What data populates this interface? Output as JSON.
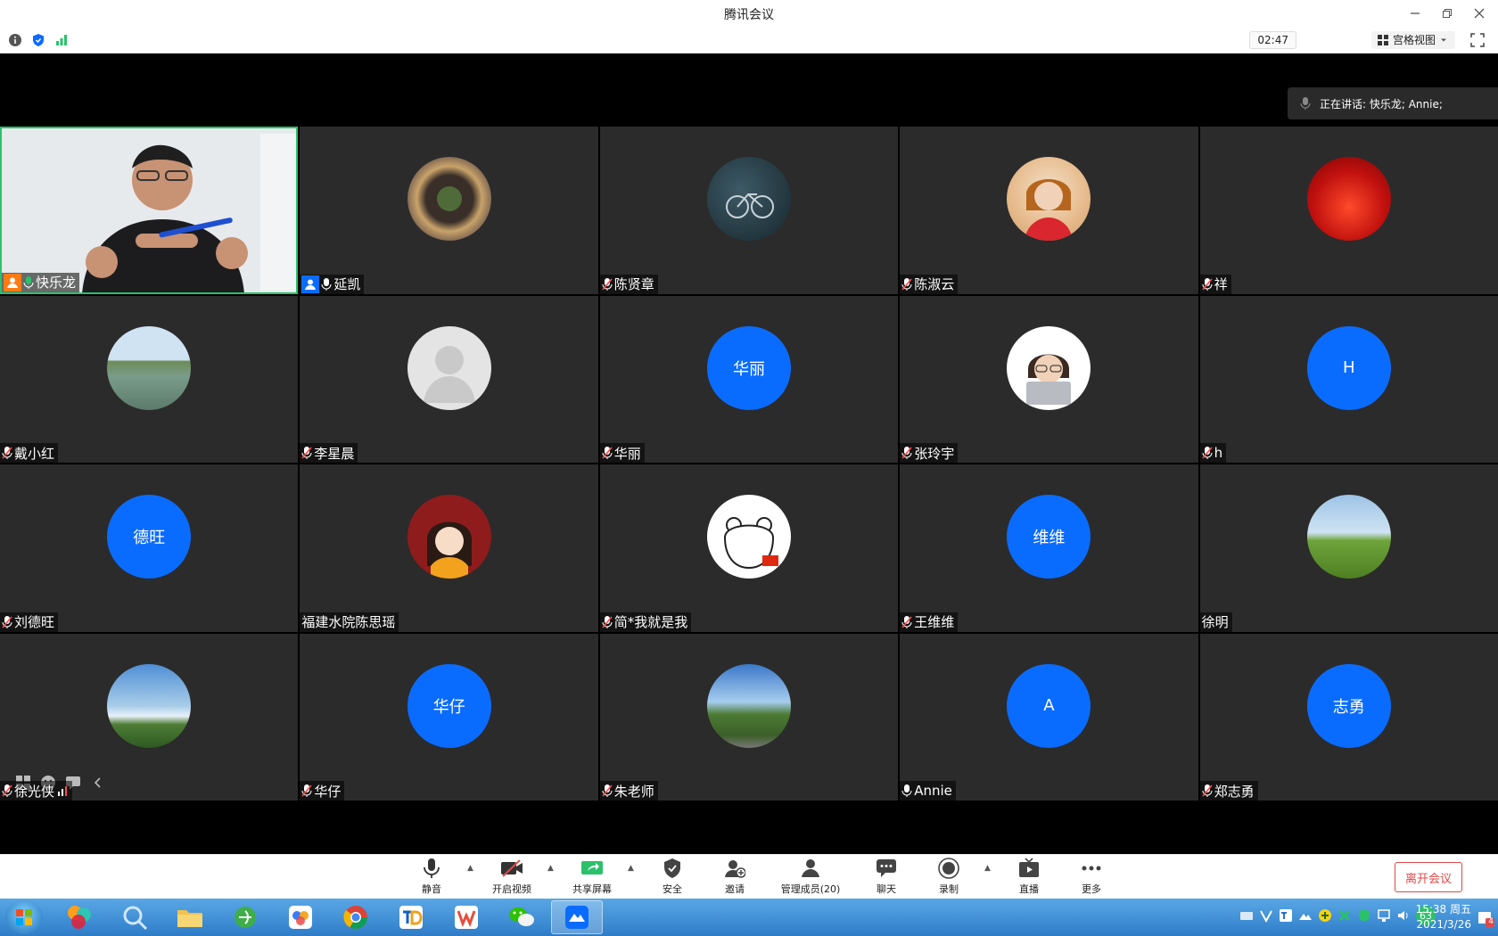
{
  "window": {
    "title": "腾讯会议"
  },
  "toolbar": {
    "timer": "02:47",
    "view_label": "宫格视图"
  },
  "speaking": {
    "text": "正在讲话: 快乐龙; Annie;"
  },
  "participants": [
    {
      "name": "快乐龙",
      "type": "video",
      "mic": "on",
      "host": "orange"
    },
    {
      "name": "延凯",
      "type": "photo",
      "mic": "on",
      "host": "blue"
    },
    {
      "name": "陈贤章",
      "type": "photo",
      "mic": "muted"
    },
    {
      "name": "陈淑云",
      "type": "photo",
      "mic": "muted"
    },
    {
      "name": "祥",
      "type": "photo",
      "mic": "muted"
    },
    {
      "name": "戴小红",
      "type": "photo",
      "mic": "muted"
    },
    {
      "name": "李星晨",
      "type": "default",
      "mic": "muted"
    },
    {
      "name": "华丽",
      "type": "initials",
      "initials": "华丽",
      "mic": "muted"
    },
    {
      "name": "张玲宇",
      "type": "photo",
      "mic": "muted"
    },
    {
      "name": "h",
      "type": "initials",
      "initials": "H",
      "mic": "muted"
    },
    {
      "name": "刘德旺",
      "type": "initials",
      "initials": "德旺",
      "mic": "muted"
    },
    {
      "name": "福建水院陈思瑶",
      "type": "photo",
      "mic": "none"
    },
    {
      "name": "简*我就是我",
      "type": "photo",
      "mic": "muted"
    },
    {
      "name": "王维维",
      "type": "initials",
      "initials": "维维",
      "mic": "muted"
    },
    {
      "name": "徐明",
      "type": "photo",
      "mic": "none"
    },
    {
      "name": "徐光侠",
      "type": "photo",
      "mic": "muted"
    },
    {
      "name": "华仔",
      "type": "initials",
      "initials": "华仔",
      "mic": "muted"
    },
    {
      "name": "朱老师",
      "type": "photo",
      "mic": "muted"
    },
    {
      "name": "Annie",
      "type": "initials",
      "initials": "A",
      "mic": "on"
    },
    {
      "name": "郑志勇",
      "type": "initials",
      "initials": "志勇",
      "mic": "muted"
    }
  ],
  "controls": {
    "mute": "静音",
    "video": "开启视频",
    "share": "共享屏幕",
    "security": "安全",
    "invite": "邀请",
    "members": "管理成员(20)",
    "chat": "聊天",
    "record": "录制",
    "live": "直播",
    "more": "更多",
    "leave": "离开会议"
  },
  "taskbar": {
    "time": "15:38 周五",
    "date": "2021/3/26",
    "tray_badge": "63",
    "notify_count": "4"
  },
  "colors": {
    "accent_blue": "#0a6cff",
    "active_border": "#2bc16b",
    "leave_red": "#e04848",
    "host_orange": "#ff7a14"
  }
}
